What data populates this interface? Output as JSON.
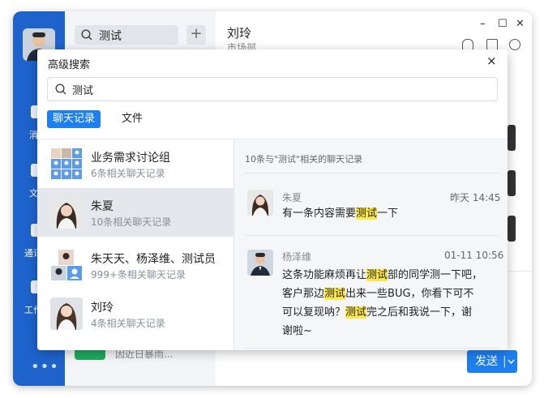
{
  "background_chat": {
    "contact_name": "刘玲",
    "contact_dept": "市场部",
    "search_value": "测试",
    "send_label": "发送",
    "preview_text": "因近日暴雨..."
  },
  "sidebar": {
    "items": [
      {
        "label": "消"
      },
      {
        "label": "文"
      },
      {
        "label": "通讯"
      },
      {
        "label": "工作"
      }
    ],
    "more": "•••"
  },
  "dialog": {
    "title": "高级搜索",
    "close": "×",
    "search_value": "测试",
    "tabs": [
      {
        "label": "聊天记录",
        "active": true
      },
      {
        "label": "文件",
        "active": false
      }
    ]
  },
  "results": [
    {
      "title": "业务需求讨论组",
      "subtitle": "6条相关聊天记录",
      "selected": false
    },
    {
      "title": "朱夏",
      "subtitle": "10条相关聊天记录",
      "selected": true
    },
    {
      "title": "朱天天、杨泽维、测试员",
      "subtitle": "999+条相关聊天记录",
      "selected": false
    },
    {
      "title": "刘玲",
      "subtitle": "4条相关聊天记录",
      "selected": false
    }
  ],
  "detail": {
    "header": "10条与\"测试\"相关的聊天记录",
    "messages": [
      {
        "sender": "朱夏",
        "time": "昨天 14:45",
        "lines": [
          [
            {
              "t": "有一条内容需要"
            },
            {
              "t": "测试",
              "hl": true
            },
            {
              "t": "一下"
            }
          ]
        ]
      },
      {
        "sender": "杨泽维",
        "time": "01-11 10:56",
        "lines": [
          [
            {
              "t": "这条功能麻烦再让"
            },
            {
              "t": "测试",
              "hl": true
            },
            {
              "t": "部的同学测一下吧，"
            }
          ],
          [
            {
              "t": "客户那边"
            },
            {
              "t": "测试",
              "hl": true
            },
            {
              "t": "出来一些BUG，你看下可不"
            }
          ],
          [
            {
              "t": "可以复现呐？"
            },
            {
              "t": "测试",
              "hl": true
            },
            {
              "t": "完之后和我说一下，谢"
            }
          ],
          [
            {
              "t": "谢啦~"
            }
          ]
        ]
      }
    ]
  },
  "colors": {
    "sidebar": "#1e63cc",
    "accent": "#1e7ff0",
    "highlight": "#ffe84a"
  }
}
